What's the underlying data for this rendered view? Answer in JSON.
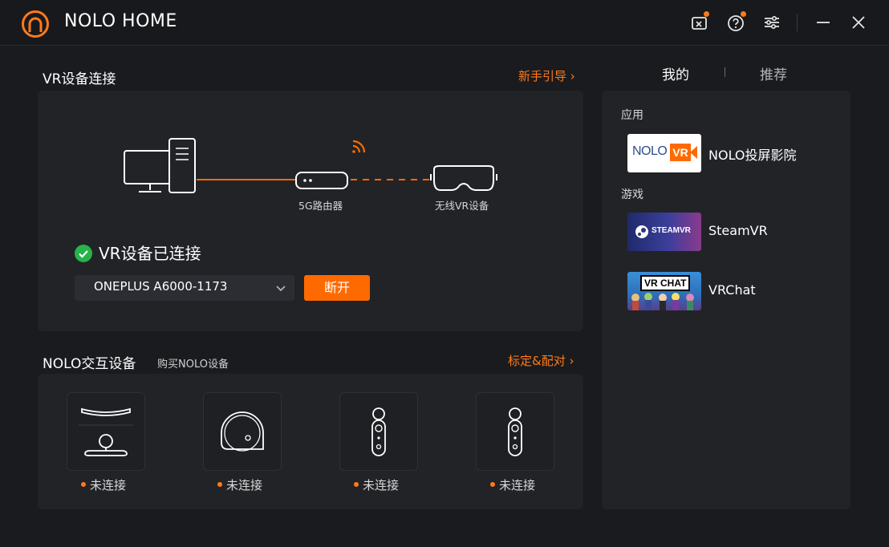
{
  "app": {
    "title": "NOLO HOME"
  },
  "titlebar": {
    "icons": [
      "toolbox-icon",
      "help-icon",
      "settings-sliders-icon",
      "minimize-icon",
      "close-icon"
    ],
    "accent": "#ff7a1a"
  },
  "vr": {
    "section_title": "VR设备连接",
    "guide_link": "新手引导 ›",
    "router_label": "5G路由器",
    "headset_label": "无线VR设备",
    "status_text": "VR设备已连接",
    "device_selected": "ONEPLUS A6000-1173",
    "disconnect_label": "断开"
  },
  "nolo": {
    "section_title": "NOLO交互设备",
    "buy_link": "购买NOLO设备",
    "calibrate_link": "标定&配对 ›",
    "devices": [
      {
        "icon": "base-station-icon",
        "status": "未连接"
      },
      {
        "icon": "headset-marker-icon",
        "status": "未连接"
      },
      {
        "icon": "controller-icon",
        "status": "未连接"
      },
      {
        "icon": "controller-icon",
        "status": "未连接"
      }
    ]
  },
  "right": {
    "tabs": [
      "我的",
      "推荐"
    ],
    "active_tab": "我的",
    "apps_label": "应用",
    "games_label": "游戏",
    "apps": [
      {
        "thumb_text": "NOLO",
        "thumb_badge": "VR",
        "name": "NOLO投屏影院"
      }
    ],
    "games": [
      {
        "thumb_text": "STEAMVR",
        "name": "SteamVR"
      },
      {
        "thumb_text": "VR CHAT",
        "name": "VRChat"
      }
    ]
  }
}
